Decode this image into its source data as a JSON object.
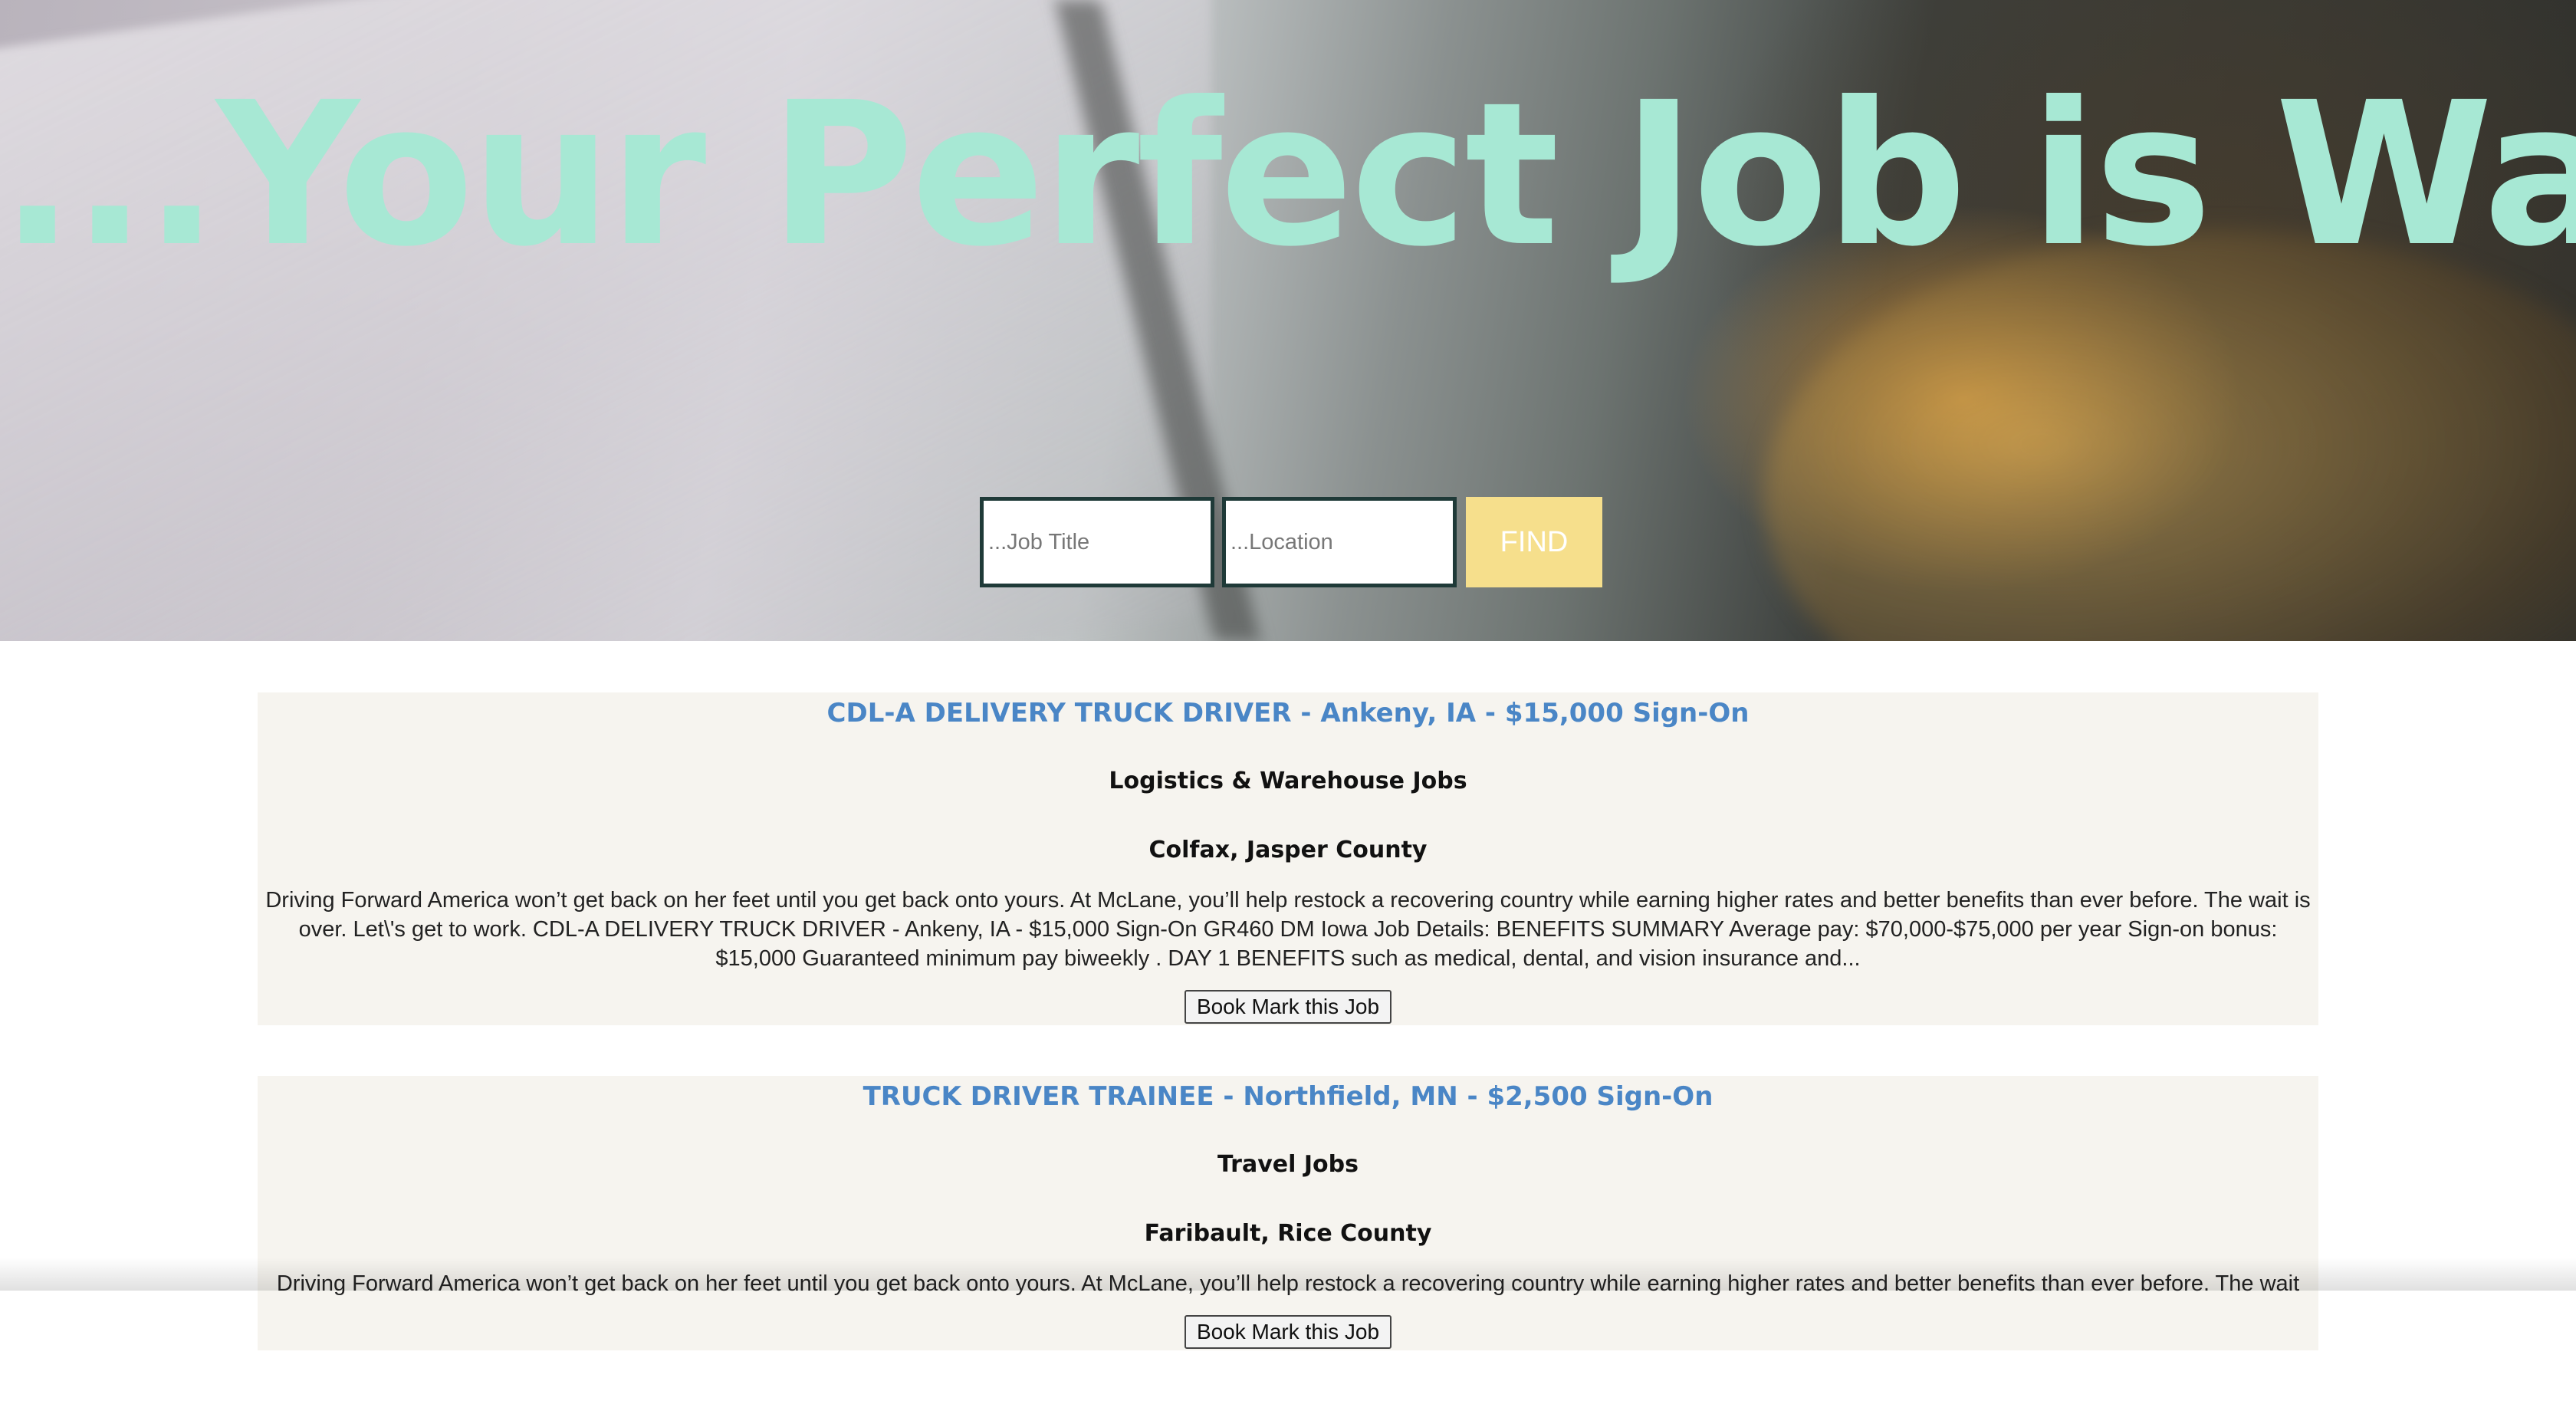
{
  "hero": {
    "title": "...Your Perfect Job is Waiting"
  },
  "search": {
    "job_title_placeholder": "...Job Title",
    "location_placeholder": "...Location",
    "find_label": "FIND"
  },
  "jobs": [
    {
      "title": "CDL-A DELIVERY TRUCK DRIVER - Ankeny, IA - $15,000 Sign-On",
      "category": "Logistics & Warehouse Jobs",
      "location": "Colfax, Jasper County",
      "description": "Driving Forward America won’t get back on her feet until you get back onto yours. At McLane, you’ll help restock a recovering country while earning higher rates and better benefits than ever before. The wait is over. Let\\'s get to work. CDL-A DELIVERY TRUCK DRIVER - Ankeny, IA - $15,000 Sign-On GR460 DM Iowa Job Details: BENEFITS SUMMARY Average pay: $70,000-$75,000 per year Sign-on bonus: $15,000 Guaranteed minimum pay biweekly . DAY 1 BENEFITS such as medical, dental, and vision insurance and...",
      "bookmark_label": "Book Mark this Job"
    },
    {
      "title": "TRUCK DRIVER TRAINEE - Northfield, MN - $2,500 Sign-On",
      "category": "Travel Jobs",
      "location": "Faribault, Rice County",
      "description": "Driving Forward America won’t get back on her feet until you get back onto yours. At McLane, you’ll help restock a recovering country while earning higher rates and better benefits than ever before. The wait",
      "bookmark_label": "Book Mark this Job"
    }
  ],
  "colors": {
    "hero_title": "#a7e8d4",
    "find_button": "#f6df8c",
    "job_title": "#4a86c6",
    "card_background": "#f6f4ef"
  }
}
